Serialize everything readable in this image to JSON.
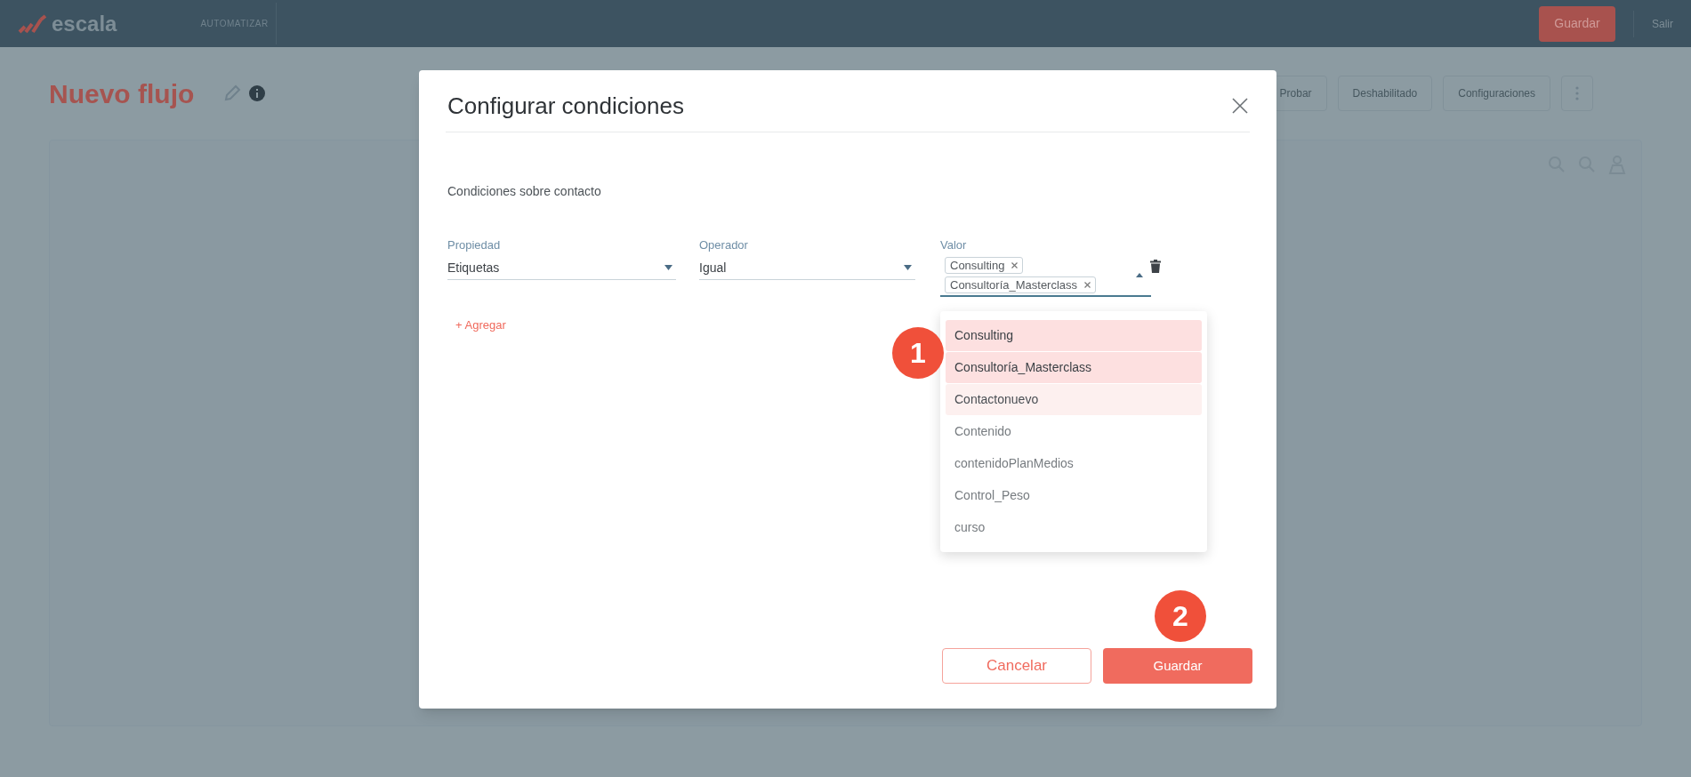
{
  "topbar": {
    "logo": "escala",
    "nav": "AUTOMATIZAR",
    "save_button": "Guardar",
    "exit": "Salir"
  },
  "page": {
    "title": "Nuevo flujo",
    "actions": [
      "Probar",
      "Deshabilitado",
      "Configuraciones"
    ]
  },
  "modal": {
    "title": "Configurar condiciones",
    "section": "Condiciones sobre contacto",
    "fields": [
      {
        "kind": "select",
        "label": "Propiedad",
        "value": "Etiquetas"
      },
      {
        "kind": "select",
        "label": "Operador",
        "value": "Igual"
      },
      {
        "kind": "tags",
        "label": "Valor",
        "expanded": true,
        "tags": [
          "Consulting",
          "Consultoría_Masterclass"
        ]
      }
    ],
    "add_link": "+ Agregar",
    "options": [
      {
        "label": "Consulting",
        "selected": true,
        "highlighted": false
      },
      {
        "label": "Consultoría_Masterclass",
        "selected": true,
        "highlighted": false
      },
      {
        "label": "Contactonuevo",
        "selected": false,
        "highlighted": true
      },
      {
        "label": "Contenido",
        "selected": false,
        "highlighted": false
      },
      {
        "label": "contenidoPlanMedios",
        "selected": false,
        "highlighted": false
      },
      {
        "label": "Control_Peso",
        "selected": false,
        "highlighted": false
      },
      {
        "label": "curso",
        "selected": false,
        "highlighted": false
      }
    ],
    "buttons": [
      {
        "kind": "secondary",
        "label": "Cancelar"
      },
      {
        "kind": "primary",
        "label": "Guardar"
      }
    ]
  },
  "annotations": [
    "1",
    "2"
  ]
}
